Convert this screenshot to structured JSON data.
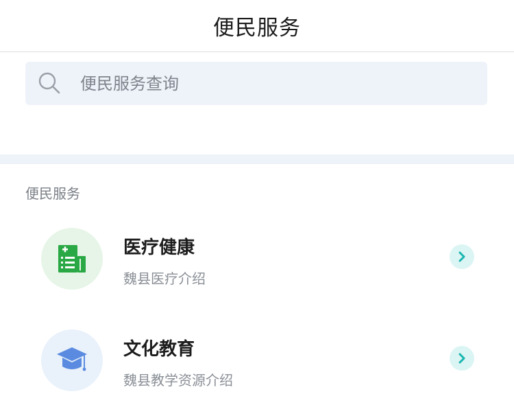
{
  "header": {
    "title": "便民服务"
  },
  "search": {
    "placeholder": "便民服务查询",
    "value": ""
  },
  "section": {
    "title": "便民服务"
  },
  "services": [
    {
      "title": "医疗健康",
      "subtitle": "魏县医疗介绍",
      "icon": "medical-record-icon",
      "icon_color": "#2aa845",
      "bg_color": "#e6f5e7"
    },
    {
      "title": "文化教育",
      "subtitle": "魏县教学资源介绍",
      "icon": "graduation-cap-icon",
      "icon_color": "#5a8be0",
      "bg_color": "#e9f1fb"
    }
  ],
  "colors": {
    "arrow": "#1ab6b0",
    "arrow_bg": "#dbf5f4",
    "band": "#eef2f9"
  }
}
